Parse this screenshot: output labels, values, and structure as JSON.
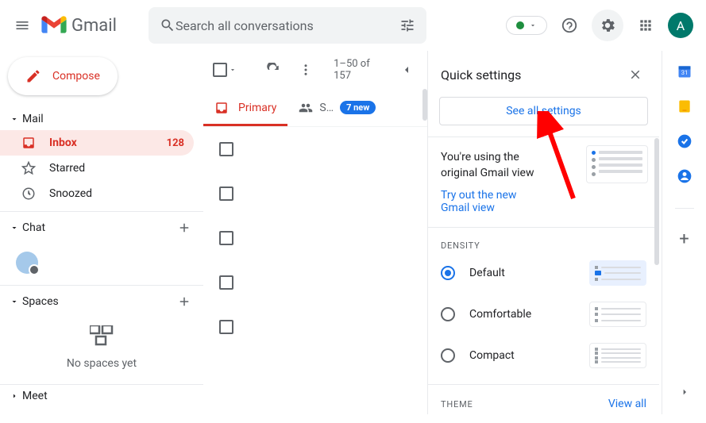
{
  "header": {
    "app_name": "Gmail",
    "search_placeholder": "Search all conversations",
    "avatar_letter": "A"
  },
  "compose_label": "Compose",
  "sidebar": {
    "mail_label": "Mail",
    "items": [
      {
        "label": "Inbox",
        "count": "128"
      },
      {
        "label": "Starred"
      },
      {
        "label": "Snoozed"
      }
    ],
    "chat_label": "Chat",
    "spaces_label": "Spaces",
    "no_spaces": "No spaces yet",
    "meet_label": "Meet"
  },
  "toolbar": {
    "page_info": "1–50 of 157"
  },
  "tabs": {
    "primary": "Primary",
    "social_short": "S…",
    "social_badge": "7 new"
  },
  "panel": {
    "title": "Quick settings",
    "see_all": "See all settings",
    "using_line1": "You're using the",
    "using_line2": "original Gmail view",
    "try_new1": "Try out the new",
    "try_new2": "Gmail view",
    "density_label": "DENSITY",
    "density": [
      "Default",
      "Comfortable",
      "Compact"
    ],
    "theme_label": "THEME",
    "view_all": "View all"
  }
}
